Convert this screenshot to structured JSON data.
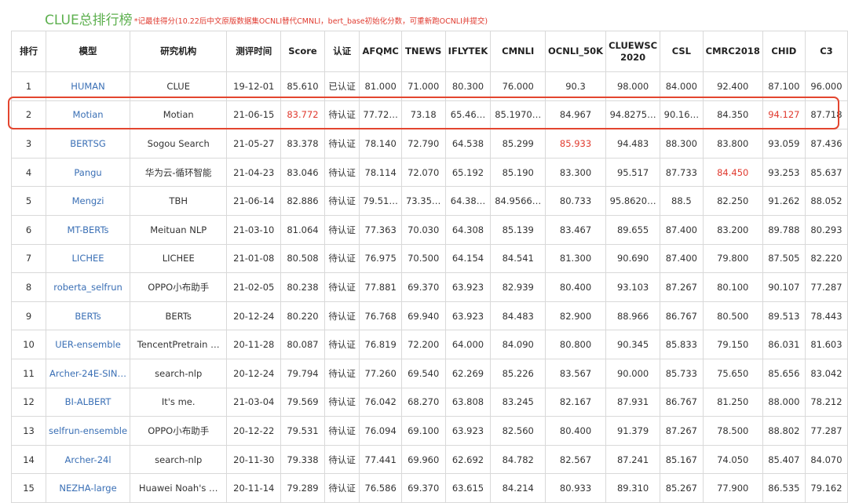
{
  "header": {
    "title": "CLUE总排行榜",
    "note": "*记最佳得分(10.22后中文原版数据集OCNLI替代CMNLI，bert_base初始化分数，可重新跑OCNLI并提交)"
  },
  "colors": {
    "title": "#5db04f",
    "note": "#e03a2f",
    "model_link": "#3a6fb5",
    "highlight": "#e3452f",
    "best_score": "#e03a2f"
  },
  "table": {
    "columns": [
      "排行",
      "模型",
      "研究机构",
      "测评时间",
      "Score",
      "认证",
      "AFQMC",
      "TNEWS",
      "IFLYTEK",
      "CMNLI",
      "OCNLI_50K",
      "CLUEWSC 2020",
      "CSL",
      "CMRC2018",
      "CHID",
      "C3"
    ],
    "highlighted_row_index": 1,
    "rows": [
      {
        "cells": [
          "1",
          "HUMAN",
          "CLUE",
          "19-12-01",
          "85.610",
          "已认证",
          "81.000",
          "71.000",
          "80.300",
          "76.000",
          "90.3",
          "98.000",
          "84.000",
          "92.400",
          "87.100",
          "96.000"
        ],
        "red": []
      },
      {
        "cells": [
          "2",
          "Motian",
          "Motian",
          "21-06-15",
          "83.772",
          "待认证",
          "77.72…",
          "73.18",
          "65.46…",
          "85.1970…",
          "84.967",
          "94.8275…",
          "90.16…",
          "84.350",
          "94.127",
          "87.718"
        ],
        "red": [
          4,
          14
        ]
      },
      {
        "cells": [
          "3",
          "BERTSG",
          "Sogou Search",
          "21-05-27",
          "83.378",
          "待认证",
          "78.140",
          "72.790",
          "64.538",
          "85.299",
          "85.933",
          "94.483",
          "88.300",
          "83.800",
          "93.059",
          "87.436"
        ],
        "red": [
          10
        ]
      },
      {
        "cells": [
          "4",
          "Pangu",
          "华为云-循环智能",
          "21-04-23",
          "83.046",
          "待认证",
          "78.114",
          "72.070",
          "65.192",
          "85.190",
          "83.300",
          "95.517",
          "87.733",
          "84.450",
          "93.253",
          "85.637"
        ],
        "red": [
          13
        ]
      },
      {
        "cells": [
          "5",
          "Mengzi",
          "TBH",
          "21-06-14",
          "82.886",
          "待认证",
          "79.51…",
          "73.35…",
          "64.38…",
          "84.9566…",
          "80.733",
          "95.8620…",
          "88.5",
          "82.250",
          "91.262",
          "88.052"
        ],
        "red": []
      },
      {
        "cells": [
          "6",
          "MT-BERTs",
          "Meituan NLP",
          "21-03-10",
          "81.064",
          "待认证",
          "77.363",
          "70.030",
          "64.308",
          "85.139",
          "83.467",
          "89.655",
          "87.400",
          "83.200",
          "89.788",
          "80.293"
        ],
        "red": []
      },
      {
        "cells": [
          "7",
          "LICHEE",
          "LICHEE",
          "21-01-08",
          "80.508",
          "待认证",
          "76.975",
          "70.500",
          "64.154",
          "84.541",
          "81.300",
          "90.690",
          "87.400",
          "79.800",
          "87.505",
          "82.220"
        ],
        "red": []
      },
      {
        "cells": [
          "8",
          "roberta_selfrun",
          "OPPO小布助手",
          "21-02-05",
          "80.238",
          "待认证",
          "77.881",
          "69.370",
          "63.923",
          "82.939",
          "80.400",
          "93.103",
          "87.267",
          "80.100",
          "90.107",
          "77.287"
        ],
        "red": []
      },
      {
        "cells": [
          "9",
          "BERTs",
          "BERTs",
          "20-12-24",
          "80.220",
          "待认证",
          "76.768",
          "69.940",
          "63.923",
          "84.483",
          "82.900",
          "88.966",
          "86.767",
          "80.500",
          "89.513",
          "78.443"
        ],
        "red": []
      },
      {
        "cells": [
          "10",
          "UER-ensemble",
          "TencentPretrain …",
          "20-11-28",
          "80.087",
          "待认证",
          "76.819",
          "72.200",
          "64.000",
          "84.090",
          "80.800",
          "90.345",
          "85.833",
          "79.150",
          "86.031",
          "81.603"
        ],
        "red": []
      },
      {
        "cells": [
          "11",
          "Archer-24E-SIN…",
          "search-nlp",
          "20-12-24",
          "79.794",
          "待认证",
          "77.260",
          "69.540",
          "62.269",
          "85.226",
          "83.567",
          "90.000",
          "85.733",
          "75.650",
          "85.656",
          "83.042"
        ],
        "red": []
      },
      {
        "cells": [
          "12",
          "BI-ALBERT",
          "It's me.",
          "21-03-04",
          "79.569",
          "待认证",
          "76.042",
          "68.270",
          "63.808",
          "83.245",
          "82.167",
          "87.931",
          "86.767",
          "81.250",
          "88.000",
          "78.212"
        ],
        "red": []
      },
      {
        "cells": [
          "13",
          "selfrun-ensemble",
          "OPPO小布助手",
          "20-12-22",
          "79.531",
          "待认证",
          "76.094",
          "69.100",
          "63.923",
          "82.560",
          "80.400",
          "91.379",
          "87.267",
          "78.500",
          "88.802",
          "77.287"
        ],
        "red": []
      },
      {
        "cells": [
          "14",
          "Archer-24l",
          "search-nlp",
          "20-11-30",
          "79.338",
          "待认证",
          "77.441",
          "69.960",
          "62.692",
          "84.782",
          "82.567",
          "87.241",
          "85.167",
          "74.050",
          "85.407",
          "84.070"
        ],
        "red": []
      },
      {
        "cells": [
          "15",
          "NEZHA-large",
          "Huawei Noah's …",
          "20-11-14",
          "79.289",
          "待认证",
          "76.586",
          "69.370",
          "63.615",
          "84.214",
          "80.933",
          "89.310",
          "85.267",
          "77.900",
          "86.535",
          "79.162"
        ],
        "red": []
      }
    ]
  }
}
